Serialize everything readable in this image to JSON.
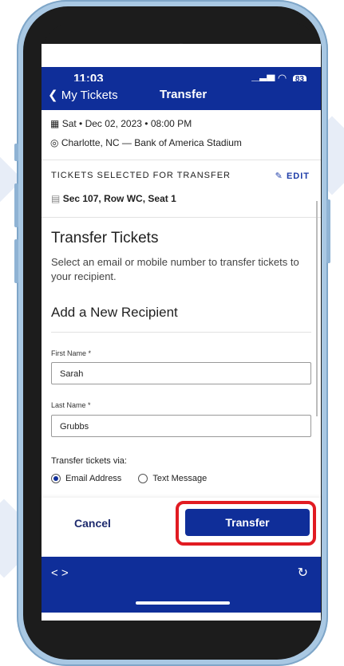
{
  "status_bar": {
    "time": "11:03",
    "signal": "📶",
    "wifi": "wifi",
    "battery": "83"
  },
  "navbar": {
    "back_label": "My Tickets",
    "title": "Transfer"
  },
  "event": {
    "date": "Sat • Dec 02, 2023 • 08:00 PM",
    "location": "Charlotte, NC — Bank of America Stadium"
  },
  "selection": {
    "label": "TICKETS SELECTED FOR TRANSFER",
    "edit_label": "EDIT",
    "seat": "Sec 107, Row WC, Seat 1"
  },
  "form": {
    "heading": "Transfer Tickets",
    "description": "Select an email or mobile number to transfer tickets to your recipient.",
    "recipient_heading": "Add a New Recipient",
    "first_name_label": "First Name *",
    "first_name_value": "Sarah",
    "last_name_label": "Last Name *",
    "last_name_value": "Grubbs",
    "via_label": "Transfer tickets via:",
    "options": [
      "Email Address",
      "Text Message"
    ],
    "selected_option": "Email Address"
  },
  "actions": {
    "cancel_label": "Cancel",
    "transfer_label": "Transfer"
  },
  "bottom": {
    "nav_arrows": "< >",
    "refresh_icon": "refresh-icon"
  },
  "colors": {
    "brand": "#0f2e99",
    "highlight": "#e11b22"
  }
}
